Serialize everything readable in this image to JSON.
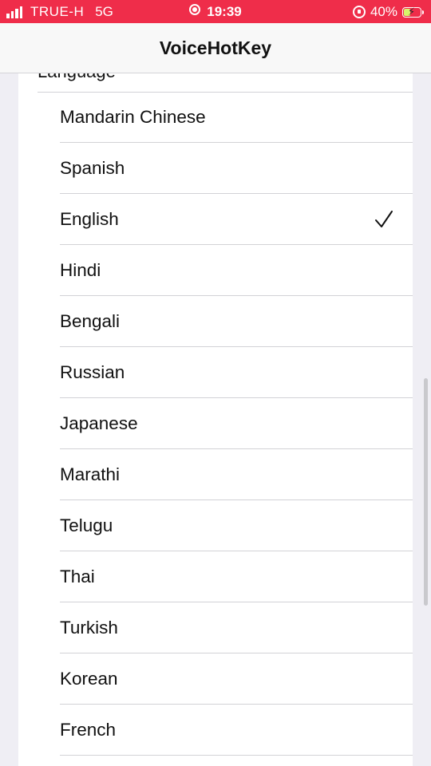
{
  "status_bar": {
    "carrier": "TRUE-H",
    "network": "5G",
    "time": "19:39",
    "battery_percent": "40%",
    "battery_level": 0.4
  },
  "nav": {
    "title": "VoiceHotKey"
  },
  "section_header": "Language",
  "languages": [
    {
      "label": "Mandarin Chinese",
      "selected": false
    },
    {
      "label": "Spanish",
      "selected": false
    },
    {
      "label": "English",
      "selected": true
    },
    {
      "label": "Hindi",
      "selected": false
    },
    {
      "label": "Bengali",
      "selected": false
    },
    {
      "label": "Russian",
      "selected": false
    },
    {
      "label": "Japanese",
      "selected": false
    },
    {
      "label": "Marathi",
      "selected": false
    },
    {
      "label": "Telugu",
      "selected": false
    },
    {
      "label": "Thai",
      "selected": false
    },
    {
      "label": "Turkish",
      "selected": false
    },
    {
      "label": "Korean",
      "selected": false
    },
    {
      "label": "French",
      "selected": false
    }
  ],
  "colors": {
    "status_bar": "#ef2d4a",
    "background": "#efeef4",
    "separator": "#d2d2d6",
    "text": "#111111"
  }
}
